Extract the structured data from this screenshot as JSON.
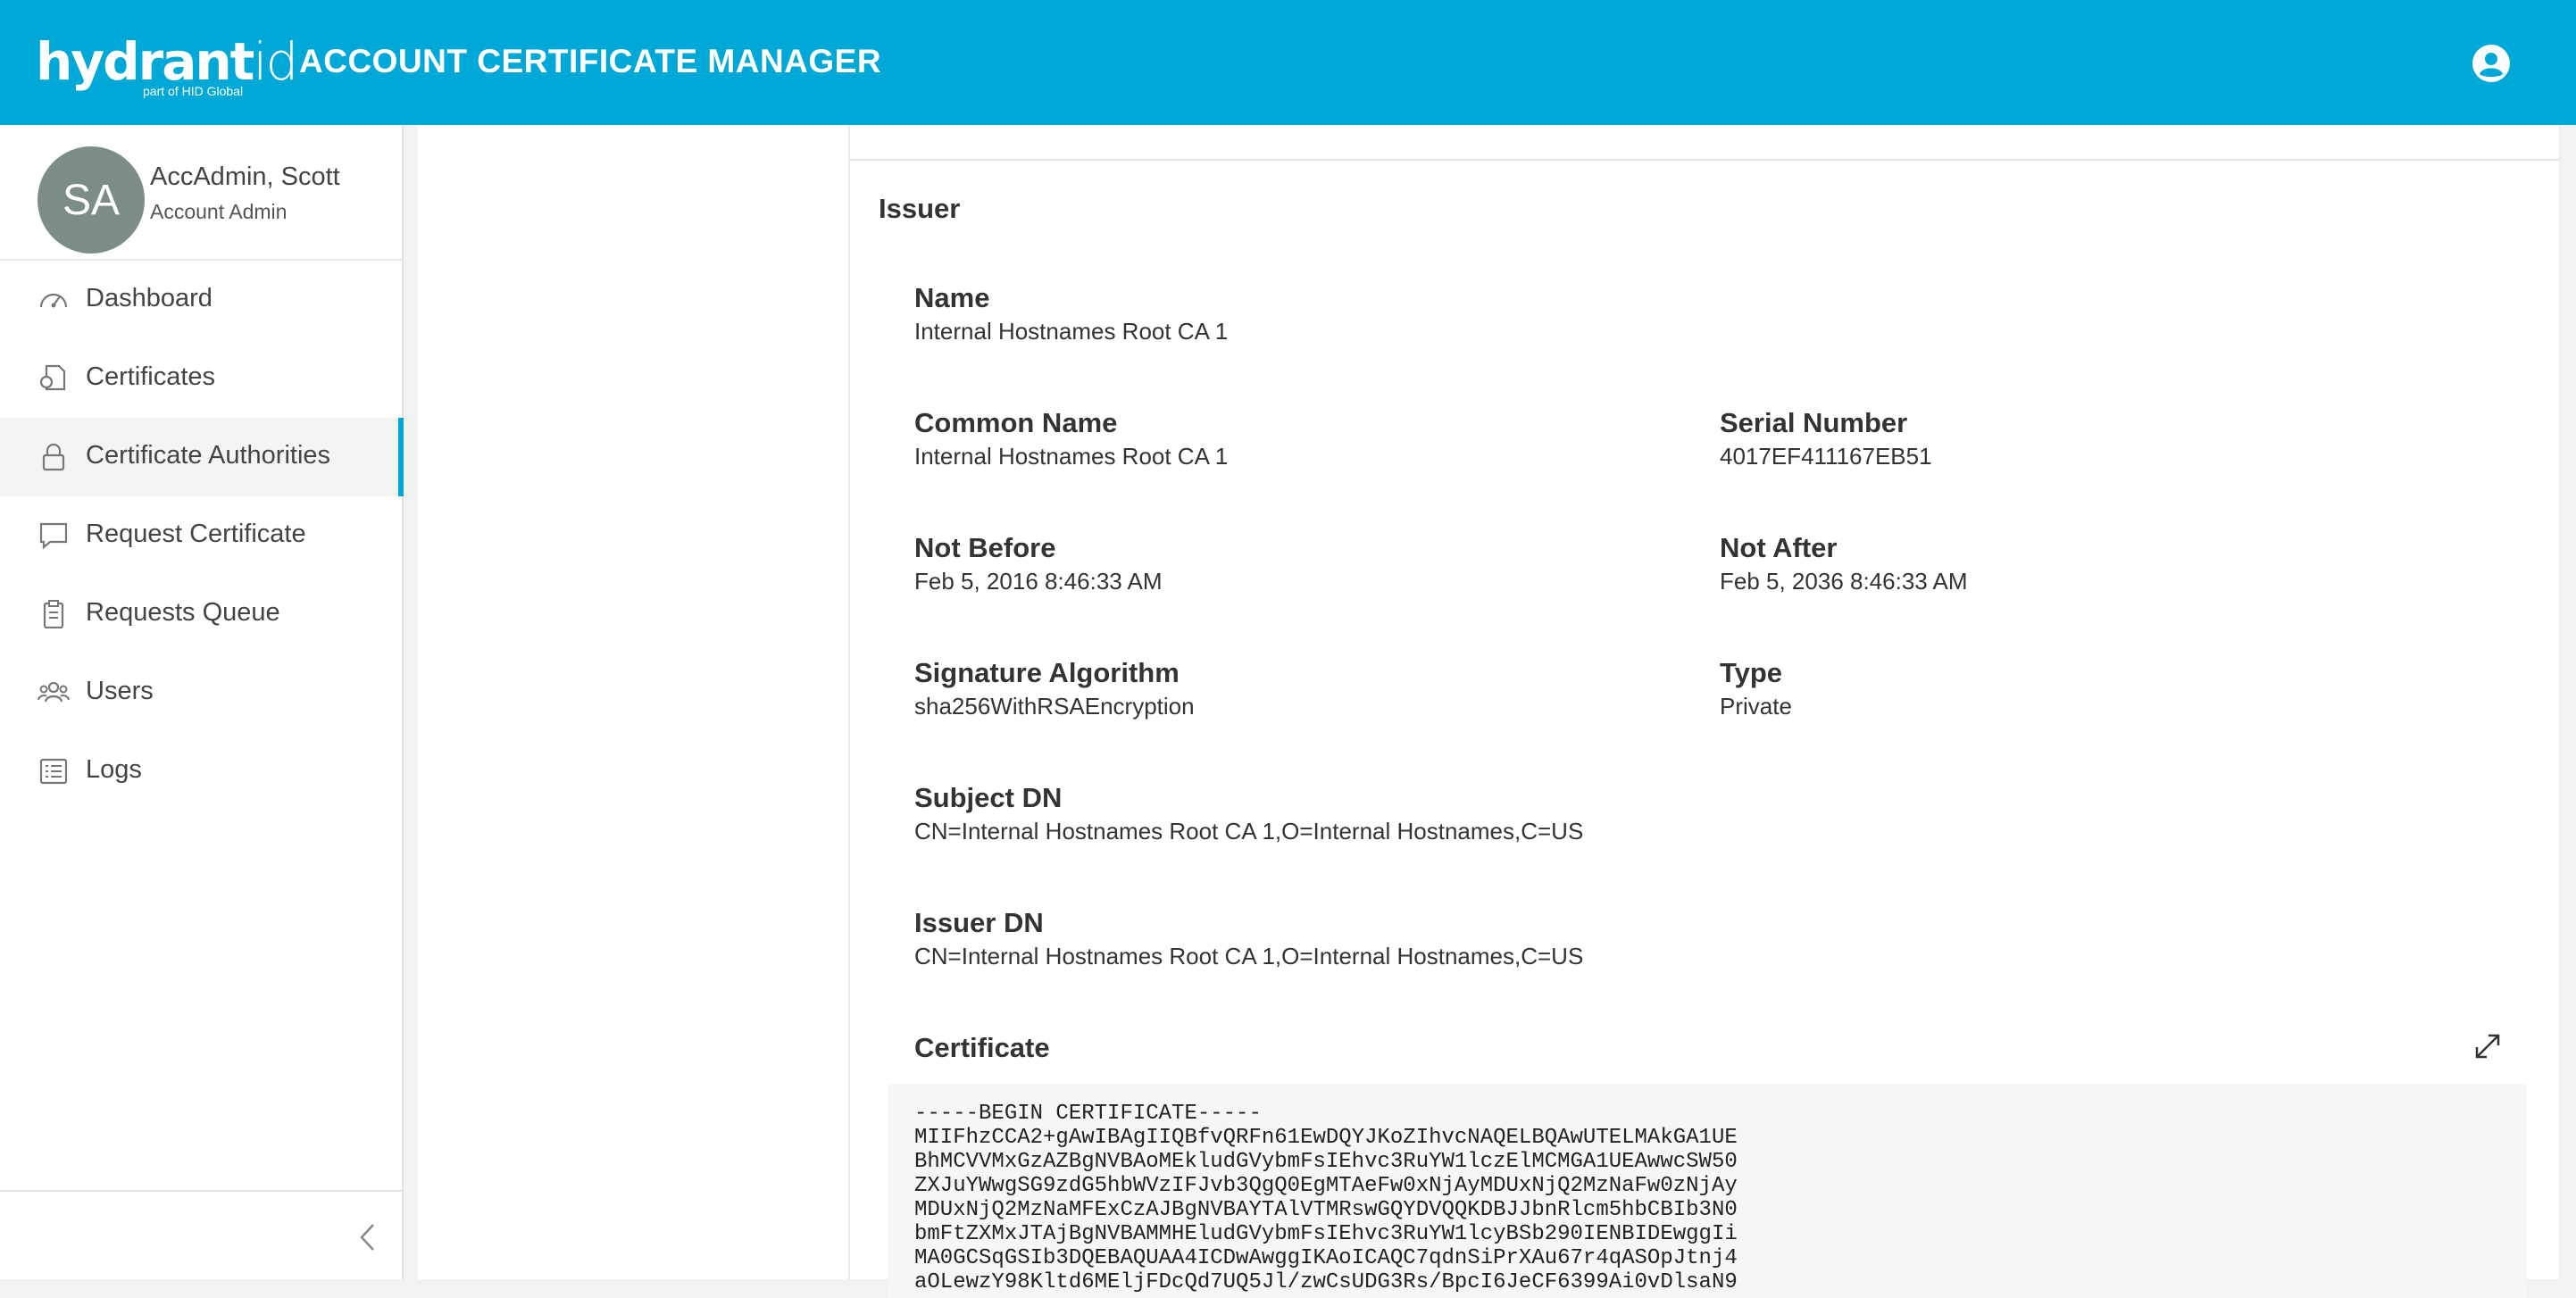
{
  "header": {
    "logo_text": "hydrant",
    "logo_text_id": "id",
    "logo_sub": "part of HID Global",
    "app_title": "ACCOUNT CERTIFICATE MANAGER",
    "user_menu_icon": "user-circle-icon"
  },
  "colors": {
    "brand": "#00a8d8",
    "avatar": "#7c8c86",
    "active_indicator": "#00a8d8"
  },
  "sidebar": {
    "profile": {
      "initials": "SA",
      "name": "AccAdmin, Scott",
      "role": "Account Admin"
    },
    "items": [
      {
        "label": "Dashboard",
        "icon": "dashboard-gauge-icon",
        "active": false
      },
      {
        "label": "Certificates",
        "icon": "certificate-icon",
        "active": false
      },
      {
        "label": "Certificate Authorities",
        "icon": "lock-icon",
        "active": true
      },
      {
        "label": "Request Certificate",
        "icon": "chat-bubble-icon",
        "active": false
      },
      {
        "label": "Requests Queue",
        "icon": "clipboard-icon",
        "active": false
      },
      {
        "label": "Users",
        "icon": "users-icon",
        "active": false
      },
      {
        "label": "Logs",
        "icon": "list-icon",
        "active": false
      }
    ],
    "collapse_icon": "chevron-left-icon"
  },
  "issuer": {
    "section_title": "Issuer",
    "name_label": "Name",
    "name_value": "Internal Hostnames Root CA 1",
    "common_name_label": "Common Name",
    "common_name_value": "Internal Hostnames Root CA 1",
    "serial_label": "Serial Number",
    "serial_value": "4017EF411167EB51",
    "not_before_label": "Not Before",
    "not_before_value": "Feb 5, 2016 8:46:33 AM",
    "not_after_label": "Not After",
    "not_after_value": "Feb 5, 2036 8:46:33 AM",
    "sig_alg_label": "Signature Algorithm",
    "sig_alg_value": "sha256WithRSAEncryption",
    "type_label": "Type",
    "type_value": "Private",
    "subject_dn_label": "Subject DN",
    "subject_dn_value": "CN=Internal Hostnames Root CA 1,O=Internal Hostnames,C=US",
    "issuer_dn_label": "Issuer DN",
    "issuer_dn_value": "CN=Internal Hostnames Root CA 1,O=Internal Hostnames,C=US",
    "certificate_label": "Certificate",
    "expand_icon": "expand-arrows-icon",
    "certificate_text": "-----BEGIN CERTIFICATE-----\nMIIFhzCCA2+gAwIBAgIIQBfvQRFn61EwDQYJKoZIhvcNAQELBQAwUTELMAkGA1UE\nBhMCVVMxGzAZBgNVBAoMEkludGVybmFsIEhvc3RuYW1lczElMCMGA1UEAwwcSW50\nZXJuYWwgSG9zdG5hbWVzIFJvb3QgQ0EgMTAeFw0xNjAyMDUxNjQ2MzNaFw0zNjAy\nMDUxNjQ2MzNaMFExCzAJBgNVBAYTAlVTMRswGQYDVQQKDBJJbnRlcm5hbCBIb3N0\nbmFtZXMxJTAjBgNVBAMMHEludGVybmFsIEhvc3RuYW1lcyBSb290IENBIDEwggIi\nMA0GCSqGSIb3DQEBAQUAA4ICDwAwggIKAoICAQC7qdnSiPrXAu67r4qASOpJtnj4\naOLewzY98Kltd6MEljFDcQd7UQ5Jl/zwCsUDG3Rs/BpcI6JeCF6399Ai0vDlsaN9"
  }
}
